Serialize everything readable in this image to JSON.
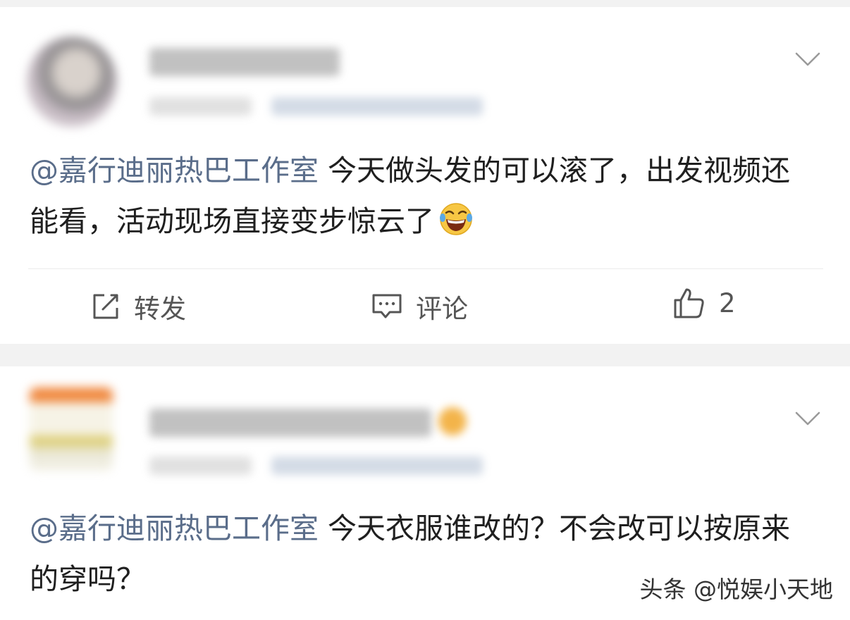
{
  "posts": [
    {
      "mention": "@嘉行迪丽热巴工作室",
      "text": " 今天做头发的可以滚了，出发视频还能看，活动现场直接变步惊云了",
      "emoji": "laugh-cry-emoji",
      "actions": {
        "repost_label": "转发",
        "comment_label": "评论",
        "like_count": "2"
      }
    },
    {
      "mention": "@嘉行迪丽热巴工作室",
      "text": " 今天衣服谁改的？不会改可以按原来的穿吗？"
    }
  ],
  "watermark": "头条 @悦娱小天地",
  "icons": {
    "more": "chevron-down-icon",
    "repost": "share-edit-icon",
    "comment": "comment-icon",
    "like": "thumbs-up-icon"
  },
  "colors": {
    "mention": "#5a6d8a",
    "separator": "#f2f2f2",
    "icon": "#555555"
  }
}
